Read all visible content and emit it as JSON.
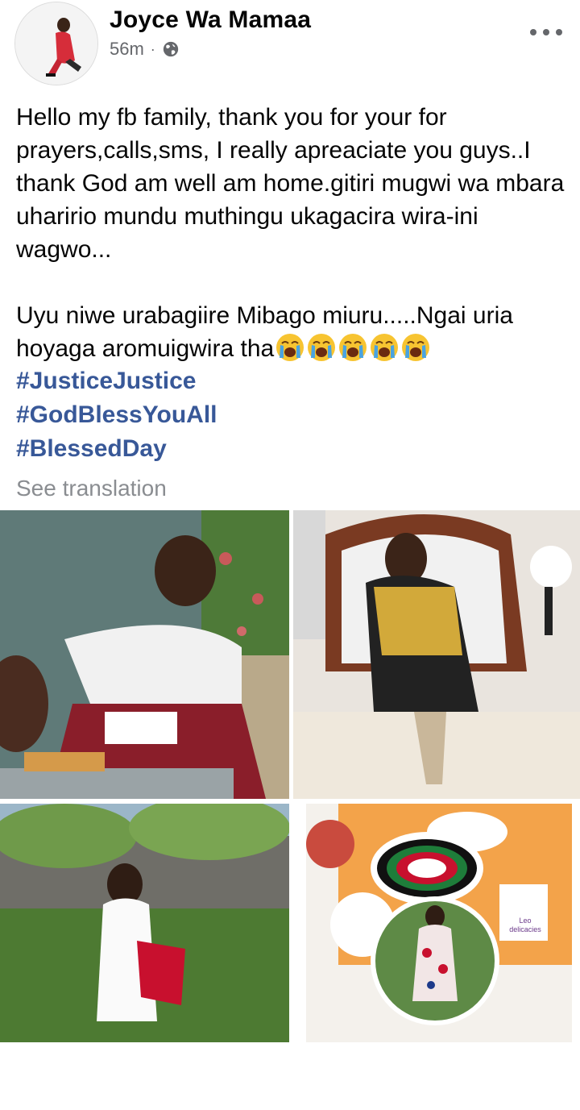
{
  "post": {
    "author": "Joyce Wa Mamaa",
    "time": "56m",
    "separator": "·",
    "audience_icon": "globe-icon",
    "more_icon": "more-options-icon",
    "paragraph1": "Hello my fb family, thank you for your for prayers,calls,sms, I really apreaciate you guys..I thank God am well am home.gitiri mugwi wa mbara uharirio mundu muthingu ukagacira wira-ini wagwo...",
    "paragraph2": "Uyu niwe urabagiire Mibago miuru.....Ngai uria hoyaga aromuigwira tha",
    "emoji_name": "loudly-crying-face-icon",
    "emoji_count": 5,
    "hashtags": [
      "#JusticeJustice",
      "#GodBlessYouAll",
      "#BlessedDay"
    ],
    "see_translation": "See translation"
  },
  "photos": {
    "photo4_sticker_text": "Leo delicacies"
  },
  "colors": {
    "hashtag": "#385898",
    "secondary_text": "#65676b",
    "translation": "#8a8d91"
  }
}
